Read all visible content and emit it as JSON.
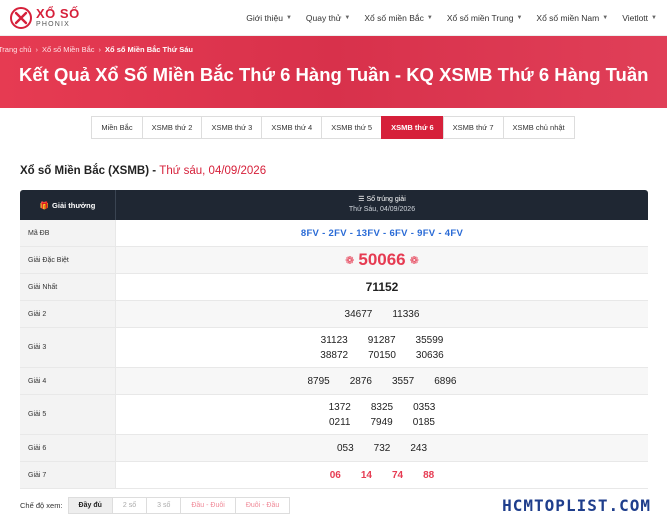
{
  "logo": {
    "main": "XỔ SỐ",
    "sub": "PHONIX"
  },
  "nav": [
    {
      "label": "Giới thiệu",
      "caret": true
    },
    {
      "label": "Quay thử",
      "caret": true
    },
    {
      "label": "Xổ số miền Bắc",
      "caret": true
    },
    {
      "label": "Xổ số miền Trung",
      "caret": true
    },
    {
      "label": "Xổ số miền Nam",
      "caret": true
    },
    {
      "label": "Vietlott",
      "caret": true
    }
  ],
  "breadcrumb": [
    "Trang chủ",
    "Xổ số Miền Bắc",
    "Xổ số Miền Bắc Thứ Sáu"
  ],
  "hero_title": "Kết Quả Xổ Số Miền Bắc Thứ 6 Hàng Tuần - KQ XSMB Thứ 6 Hàng Tuần",
  "tabs": [
    "Miền Bắc",
    "XSMB thứ 2",
    "XSMB thứ 3",
    "XSMB thứ 4",
    "XSMB thứ 5",
    "XSMB thứ 6",
    "XSMB thứ 7",
    "XSMB chủ nhật"
  ],
  "section": {
    "title": "Xổ số Miền Bắc (XSMB) - ",
    "date": "Thứ sáu, 04/09/2026"
  },
  "table": {
    "head_left": "Giải thưởng",
    "head_right": "Số trúng giải",
    "head_right_sub": "Thứ Sáu, 04/09/2026",
    "ma_db_label": "Mã ĐB",
    "ma_db": "8FV - 2FV - 13FV - 6FV - 9FV - 4FV",
    "special_label": "Giải Đặc Biệt",
    "special": "50066",
    "first_label": "Giải Nhất",
    "first": "71152",
    "g2_label": "Giải 2",
    "g2": [
      "34677",
      "11336"
    ],
    "g3_label": "Giải 3",
    "g3a": [
      "31123",
      "91287",
      "35599"
    ],
    "g3b": [
      "38872",
      "70150",
      "30636"
    ],
    "g4_label": "Giải 4",
    "g4": [
      "8795",
      "2876",
      "3557",
      "6896"
    ],
    "g5_label": "Giải 5",
    "g5a": [
      "1372",
      "8325",
      "0353"
    ],
    "g5b": [
      "0211",
      "7949",
      "0185"
    ],
    "g6_label": "Giải 6",
    "g6": [
      "053",
      "732",
      "243"
    ],
    "g7_label": "Giải 7",
    "g7": [
      "06",
      "14",
      "74",
      "88"
    ]
  },
  "modebar": {
    "label": "Chế độ xem:",
    "modes": [
      "Đầy đủ",
      "2 số",
      "3 số",
      "Đầu - Đuôi",
      "Đuôi - Đầu"
    ]
  },
  "watermark": "HCMTOPLIST.COM",
  "colors": {
    "brand": "#d6203a",
    "header_dark": "#1f2733",
    "blue": "#2a6bd6"
  }
}
